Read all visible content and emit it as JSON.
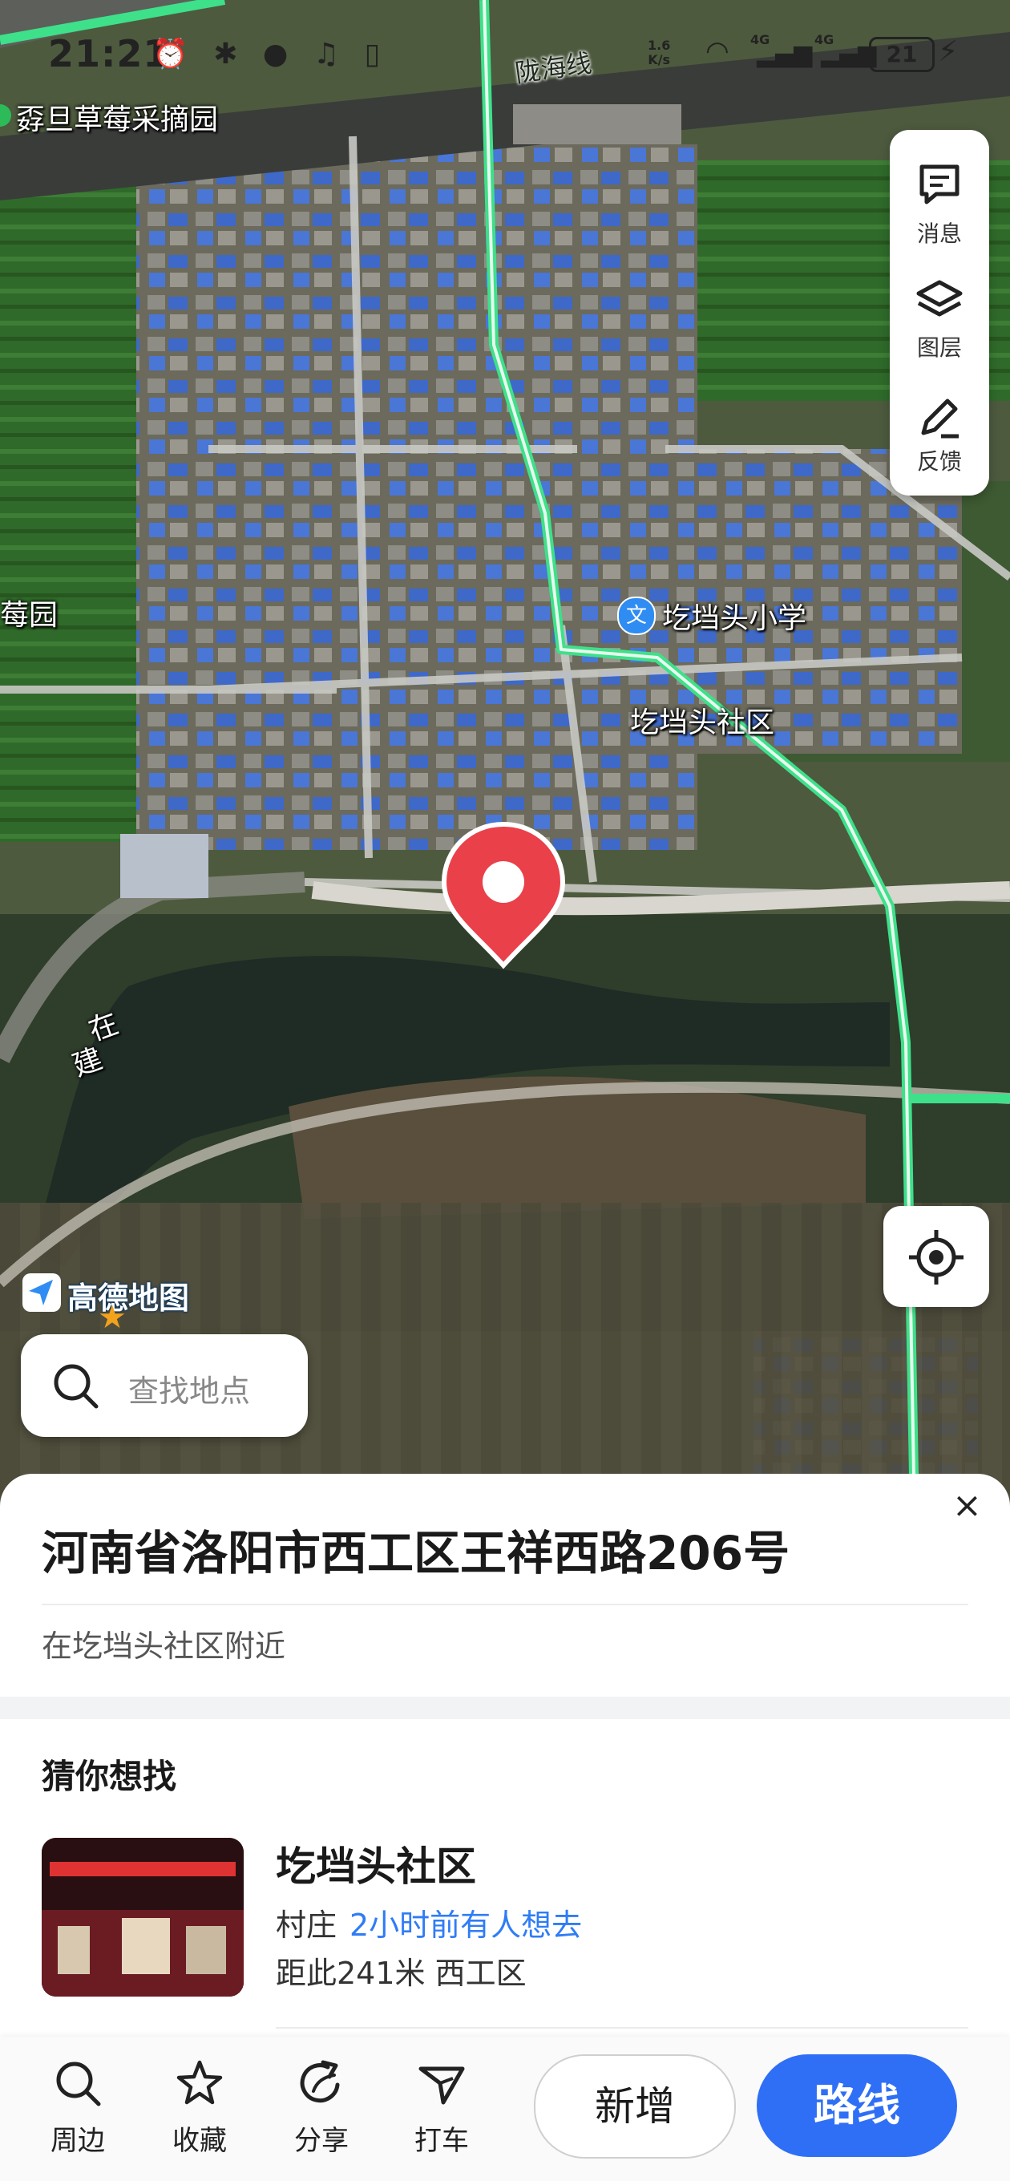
{
  "status_bar": {
    "time": "21:21",
    "net_speed_value": "1.6",
    "net_speed_unit": "K/s",
    "sig1": "4G",
    "sig2": "4G",
    "battery": "21"
  },
  "map": {
    "labels": {
      "farm": "孬旦草莓采摘园",
      "farm_partial": "莓园",
      "railway": "陇海线",
      "school": "圪垱头小学",
      "school_icon_char": "文",
      "community": "圪垱头社区",
      "construction_1": "在",
      "construction_2": "建"
    },
    "logo": "高德地图"
  },
  "right_panel": {
    "message": "消息",
    "layers": "图层",
    "feedback": "反馈"
  },
  "search": {
    "placeholder": "查找地点"
  },
  "sheet": {
    "close": "×",
    "address": "河南省洛阳市西工区王祥西路206号",
    "nearby": "在圪垱头社区附近",
    "guess_title": "猜你想找",
    "card": {
      "title": "圪垱头社区",
      "type": "村庄",
      "hot": "2小时前有人想去",
      "distance": "距此241米  西工区"
    }
  },
  "bottom_bar": {
    "nearby": "周边",
    "favorite": "收藏",
    "share": "分享",
    "taxi": "打车",
    "add": "新增",
    "route": "路线"
  },
  "colors": {
    "accent": "#2f6ff6",
    "pin": "#e9404a",
    "road_green": "#3ee08a"
  }
}
